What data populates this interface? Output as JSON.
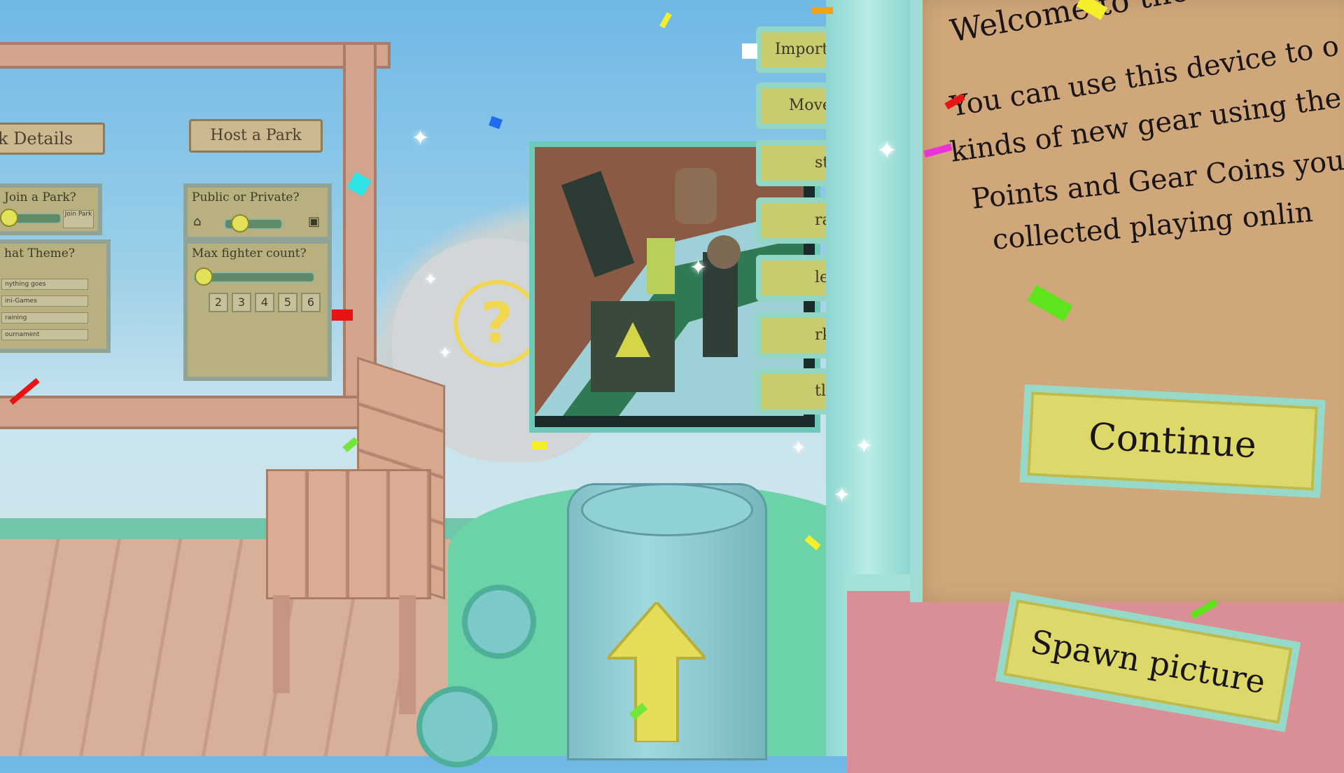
{
  "scene": {
    "left_board": {
      "partial_title": "k Details",
      "host_sign": "Host a Park",
      "join_panel": {
        "title": "Join a Park?",
        "small_button": "Join Park"
      },
      "theme_panel": {
        "title": "hat Theme?",
        "options": [
          "nything goes",
          "ini-Games",
          "raining",
          "ournament"
        ]
      },
      "public_panel": {
        "title": "Public or Private?"
      },
      "fighter_panel": {
        "title": "Max fighter count?",
        "counts": [
          "2",
          "3",
          "4",
          "5",
          "6"
        ]
      }
    },
    "help_icon": "question-icon",
    "menu_tabs": [
      {
        "label": "Important"
      },
      {
        "label": "Moves"
      },
      {
        "label": "stones"
      },
      {
        "label": "racter"
      },
      {
        "label": "le Suit"
      },
      {
        "label": "rkings"
      },
      {
        "label": "tles"
      }
    ],
    "gear_card": {
      "line1": "Welcome to the Gear Ma",
      "line2": "You can use this device to o",
      "line3": "kinds of new gear using the",
      "line4": "Points and Gear Coins you",
      "line5": "collected playing onlin",
      "continue_label": "Continue",
      "spawn_label": "Spawn picture"
    },
    "preview_picture": "robot-arm-image",
    "machine_arrow": "up-arrow-icon"
  },
  "colors": {
    "sky": "#9bcfe8",
    "wood": "#c49580",
    "card": "#cfa77a",
    "teal_trim": "#96d9c8",
    "button_yellow": "#dcd96a"
  }
}
